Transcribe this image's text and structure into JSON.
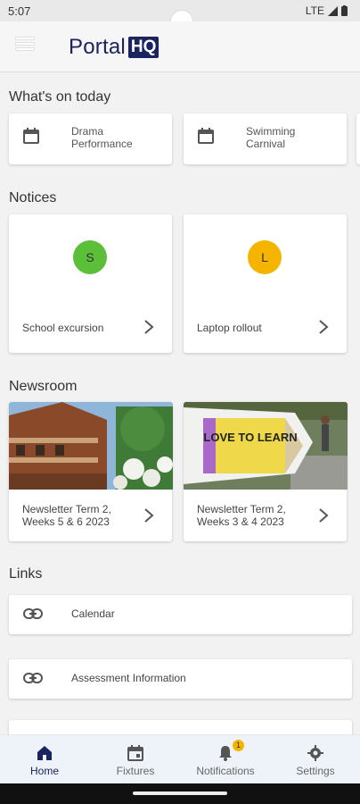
{
  "status": {
    "time": "5:07",
    "network": "LTE"
  },
  "brand": {
    "word": "Portal",
    "box": "HQ",
    "color": "#1b2360"
  },
  "sections": {
    "today": "What's on today",
    "notices": "Notices",
    "newsroom": "Newsroom",
    "links": "Links"
  },
  "events": [
    {
      "label": "Drama Performance",
      "icon": "calendar-icon"
    },
    {
      "label": "Swimming Carnival",
      "icon": "calendar-icon"
    }
  ],
  "notices": [
    {
      "initial": "S",
      "color": "#5cbf3a",
      "label": "School excursion"
    },
    {
      "initial": "L",
      "color": "#f5b400",
      "label": "Laptop rollout"
    }
  ],
  "news": [
    {
      "label": "Newsletter Term 2, Weeks 5 & 6 2023"
    },
    {
      "label": "Newsletter Term 2, Weeks 3 & 4 2023",
      "sign_text": "LOVE TO LEARN"
    }
  ],
  "links": [
    {
      "label": "Calendar",
      "icon": "link-icon"
    },
    {
      "label": "Assessment Information",
      "icon": "link-icon"
    }
  ],
  "nav": [
    {
      "label": "Home",
      "icon": "home-icon",
      "active": true
    },
    {
      "label": "Fixtures",
      "icon": "calendar-icon"
    },
    {
      "label": "Notifications",
      "icon": "bell-icon",
      "badge": "1"
    },
    {
      "label": "Settings",
      "icon": "gear-icon"
    }
  ]
}
